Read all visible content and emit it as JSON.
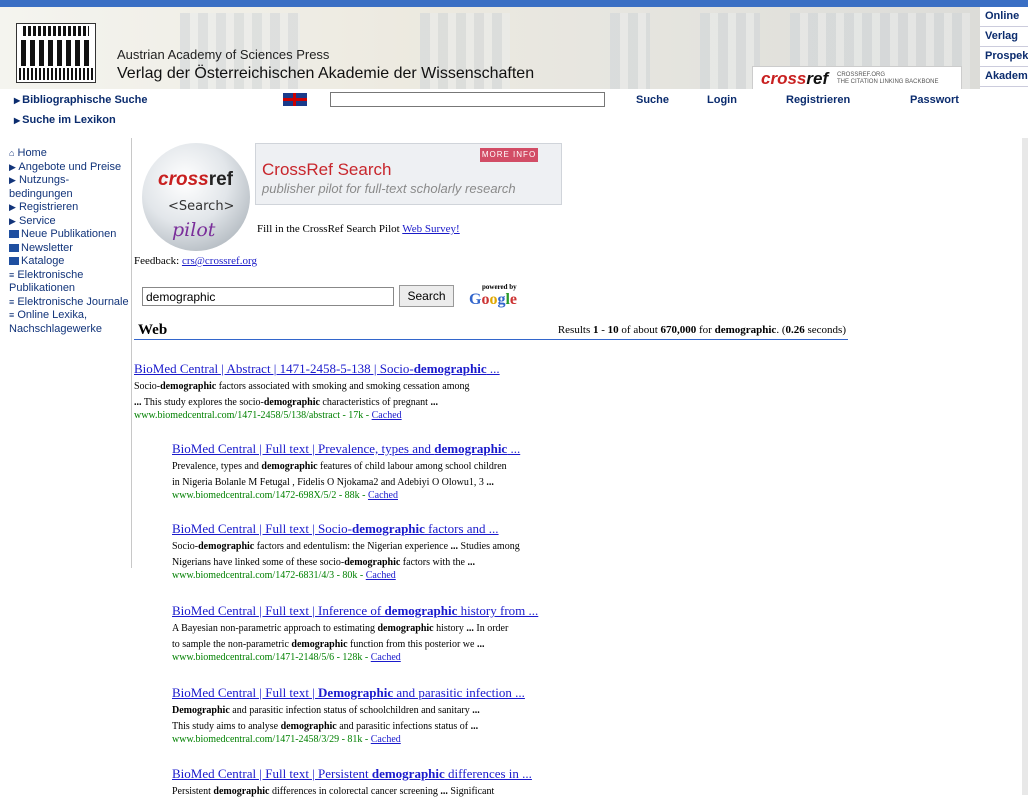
{
  "header": {
    "publisher_en": "Austrian Academy of Sciences Press",
    "publisher_de": "Verlag der Österreichischen Akademie der Wissenschaften",
    "crossref_logo": "cross",
    "crossref_logo_b": "ref",
    "crossref_tag1": "CROSSREF.ORG",
    "crossref_tag2": "THE CITATION LINKING BACKBONE"
  },
  "right_nav": [
    "Online",
    "Verlag",
    "Prospek",
    "Akadem"
  ],
  "top_nav": {
    "biblio": "Bibliographische Suche",
    "lexikon": "Suche im Lexikon",
    "suche": "Suche",
    "login": "Login",
    "registrieren": "Registrieren",
    "passwort": "Passwort",
    "flag_icon": "uk-flag-icon"
  },
  "left_nav": [
    {
      "label": "Home",
      "icon": "home-icon"
    },
    {
      "label": "Angebote und Preise",
      "icon": "triangle-icon"
    },
    {
      "label": "Nutzungs-bedingungen",
      "icon": "triangle-icon"
    },
    {
      "label": "Registrieren",
      "icon": "triangle-icon"
    },
    {
      "label": "Service",
      "icon": "triangle-icon"
    },
    {
      "label": "Neue Publikationen",
      "icon": "square-icon"
    },
    {
      "label": "Newsletter",
      "icon": "square-icon"
    },
    {
      "label": "Kataloge",
      "icon": "square-icon"
    },
    {
      "label": "Elektronische Publikationen",
      "icon": "list-icon"
    },
    {
      "label": "Elektronische Journale",
      "icon": "list-icon"
    },
    {
      "label": "Online Lexika, Nachschlagewerke",
      "icon": "list-icon"
    }
  ],
  "crossref_banner": {
    "ball_cross": "cross",
    "ball_ref": "ref",
    "ball_search": "<Search>",
    "ball_pilot": "pilot",
    "title": "CrossRef Search",
    "subtitle": "publisher pilot for full-text scholarly research",
    "more_info": "MORE INFO"
  },
  "survey": {
    "prefix": "Fill in the CrossRef Search Pilot ",
    "link": "Web Survey!"
  },
  "feedback": {
    "prefix": "Feedback: ",
    "email": "crs@crossref.org"
  },
  "search": {
    "value": "demographic",
    "button": "Search",
    "powered_by": "powered by",
    "google": "Google"
  },
  "results_header": {
    "web": "Web",
    "p1": "Results ",
    "from": "1",
    "p2": " - ",
    "to": "10",
    "p3": " of about ",
    "total": "670,000",
    "p4": " for ",
    "query": "demographic",
    "p5": ". (",
    "time": "0.26",
    "p6": " seconds)"
  },
  "results": [
    {
      "title": [
        "BioMed Central | Abstract | 1471-2458-5-138 | Socio-",
        "demographic",
        " ..."
      ],
      "lines": [
        [
          "Socio-",
          "demographic",
          " factors associated with smoking and smoking cessation among"
        ],
        [
          "...",
          " This study explores the socio-",
          "demographic",
          " characteristics of pregnant ",
          "..."
        ]
      ],
      "url": "www.biomedcentral.com/1471-2458/5/138/abstract - 17k - ",
      "cached": "Cached"
    },
    {
      "title": [
        "BioMed Central | Full text | Prevalence, types and ",
        "demographic",
        " ..."
      ],
      "lines": [
        [
          "Prevalence, types and ",
          "demographic",
          " features of child labour among school children"
        ],
        [
          "in Nigeria Bolanle M Fetugal , Fidelis O Njokama2 and Adebiyi O Olowu1, 3 ",
          "..."
        ]
      ],
      "url": "www.biomedcentral.com/1472-698X/5/2 - 88k - ",
      "cached": "Cached"
    },
    {
      "title": [
        "BioMed Central | Full text | Socio-",
        "demographic",
        " factors and ..."
      ],
      "lines": [
        [
          "Socio-",
          "demographic",
          " factors and edentulism: the Nigerian experience ",
          "...",
          " Studies among"
        ],
        [
          "Nigerians have linked some of these socio-",
          "demographic",
          " factors with the ",
          "..."
        ]
      ],
      "url": "www.biomedcentral.com/1472-6831/4/3 - 80k - ",
      "cached": "Cached"
    },
    {
      "title": [
        "BioMed Central | Full text | Inference of ",
        "demographic",
        " history from ..."
      ],
      "lines": [
        [
          "A Bayesian non-parametric approach to estimating ",
          "demographic",
          " history ",
          "...",
          " In order"
        ],
        [
          "to sample the non-parametric ",
          "demographic",
          " function from this posterior we ",
          "..."
        ]
      ],
      "url": "www.biomedcentral.com/1471-2148/5/6 - 128k - ",
      "cached": "Cached"
    },
    {
      "title": [
        "BioMed Central | Full text | ",
        "Demographic",
        " and parasitic infection ..."
      ],
      "lines": [
        [
          "",
          "Demographic",
          " and parasitic infection status of schoolchildren and sanitary ",
          "..."
        ],
        [
          "This study aims to analyse ",
          "demographic",
          " and parasitic infections status of ",
          "..."
        ]
      ],
      "url": "www.biomedcentral.com/1471-2458/3/29 - 81k - ",
      "cached": "Cached"
    },
    {
      "title": [
        "BioMed Central | Full text | Persistent ",
        "demographic",
        " differences in ..."
      ],
      "lines": [
        [
          "Persistent ",
          "demographic",
          " differences in colorectal cancer screening ",
          "...",
          " Significant"
        ]
      ],
      "url": "",
      "cached": ""
    }
  ]
}
